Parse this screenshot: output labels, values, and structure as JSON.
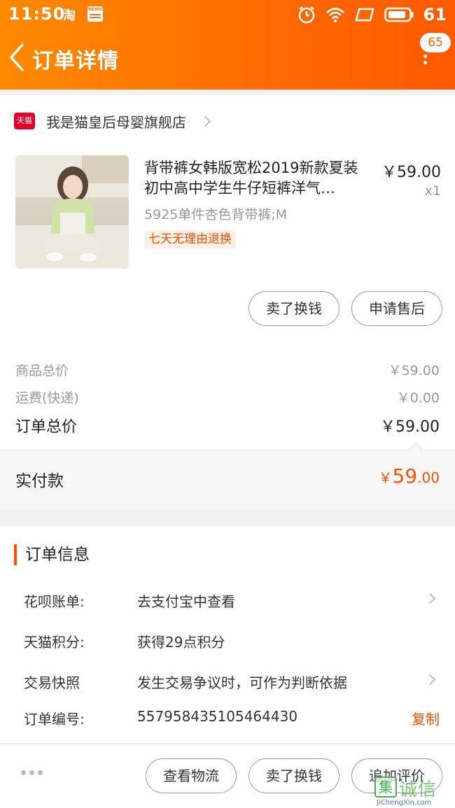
{
  "status_bar": {
    "time": "11:50",
    "app_icon": "淘",
    "news_icon": "NEWS",
    "battery": "61"
  },
  "header": {
    "title": "订单详情",
    "badge_count": "65",
    "accent_color": "#ff6a00"
  },
  "shop": {
    "logo_text": "天猫",
    "name": "我是猫皇后母婴旗舰店"
  },
  "product": {
    "title": "背带裤女韩版宽松2019新款夏装初中高中学生牛仔短裤洋气…",
    "price": "￥59.00",
    "quantity": "x1",
    "sku": "5925单件杏色背带裤;M",
    "tag": "七天无理由退换"
  },
  "item_actions": {
    "sell_label": "卖了换钱",
    "after_sale_label": "申请售后"
  },
  "summary": {
    "goods_total_label": "商品总价",
    "goods_total_value": "￥59.00",
    "shipping_label": "运费(快递)",
    "shipping_value": "￥0.00",
    "order_total_label": "订单总价",
    "order_total_value": "￥59.00",
    "paid_label": "实付款",
    "paid_symbol": "￥",
    "paid_int": "59",
    "paid_dec": ".00"
  },
  "order_info": {
    "heading": "订单信息",
    "rows": [
      {
        "label": "花呗账单:",
        "value": "去支付宝中查看"
      },
      {
        "label": "天猫积分:",
        "value": "获得29点积分"
      },
      {
        "label": "交易快照",
        "value": "发生交易争议时，可作为判断依据"
      },
      {
        "label": "订单编号:",
        "value": "557958435105464430"
      }
    ],
    "copy_label": "复制"
  },
  "bottom_actions": {
    "logistics_label": "查看物流",
    "sell_label": "卖了换钱",
    "review_label": "追加评价"
  },
  "watermark": {
    "logo_char": "集",
    "cn": "诚信",
    "en": "JiChengXin.com"
  }
}
